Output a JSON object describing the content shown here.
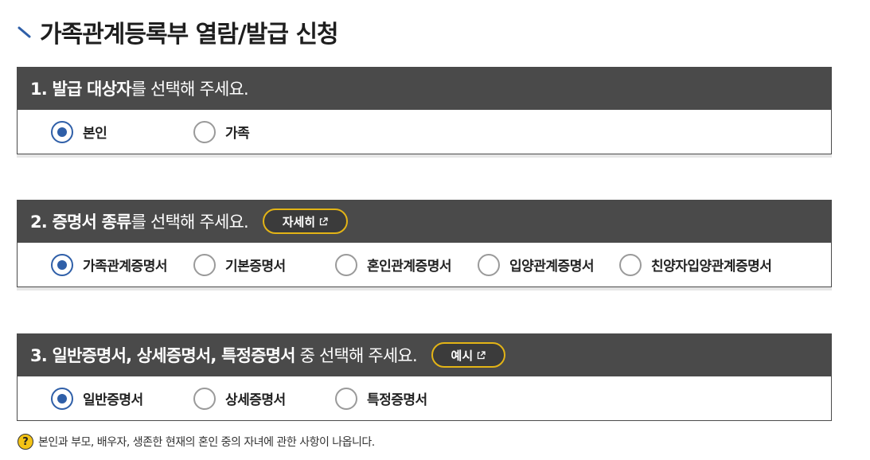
{
  "page": {
    "title": "가족관계등록부 열람/발급 신청"
  },
  "section1": {
    "question_bold": "1. 발급 대상자",
    "question_rest": "를 선택해 주세요.",
    "options": [
      {
        "label": "본인",
        "selected": true
      },
      {
        "label": "가족",
        "selected": false
      }
    ]
  },
  "section2": {
    "question_bold": "2. 증명서 종류",
    "question_rest": "를 선택해 주세요.",
    "button_label": "자세히",
    "options": [
      {
        "label": "가족관계증명서",
        "selected": true
      },
      {
        "label": "기본증명서",
        "selected": false
      },
      {
        "label": "혼인관계증명서",
        "selected": false
      },
      {
        "label": "입양관계증명서",
        "selected": false
      },
      {
        "label": "친양자입양관계증명서",
        "selected": false
      }
    ]
  },
  "section3": {
    "question_bold": "3. 일반증명서, 상세증명서, 특정증명서",
    "question_rest": " 중 선택해 주세요.",
    "button_label": "예시",
    "options": [
      {
        "label": "일반증명서",
        "selected": true
      },
      {
        "label": "상세증명서",
        "selected": false
      },
      {
        "label": "특정증명서",
        "selected": false
      }
    ]
  },
  "note": {
    "icon_text": "?",
    "text": "본인과 부모, 배우자, 생존한 현재의 혼인 중의 자녀에 관한 사항이 나옵니다."
  },
  "colors": {
    "header_bg": "#4a4a4a",
    "radio_selected": "#2f5fa8",
    "accent": "#e3b416",
    "title_mark": "#2f5fa8"
  },
  "icons": {
    "title_mark": "slash-mark-icon",
    "external_link": "external-link-icon",
    "help": "question-circle-icon"
  }
}
